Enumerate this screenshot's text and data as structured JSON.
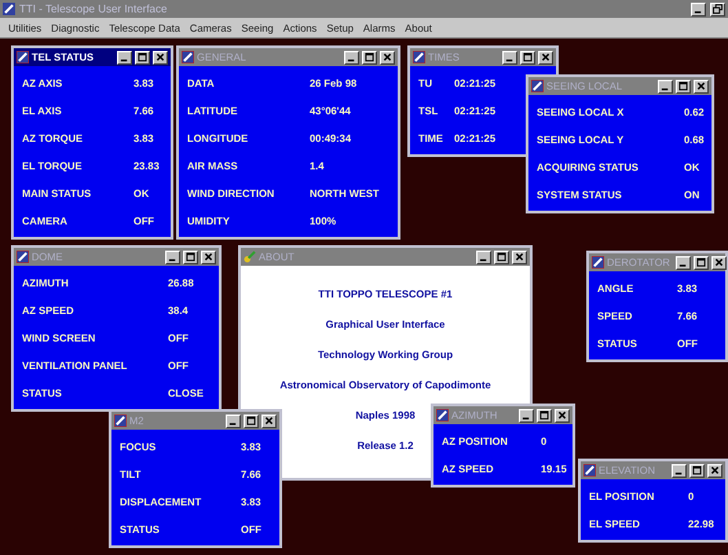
{
  "app": {
    "title": "TTI - Telescope User Interface",
    "active": false
  },
  "menu": [
    "Utilities",
    "Diagnostic",
    "Telescope Data",
    "Cameras",
    "Seeing",
    "Actions",
    "Setup",
    "Alarms",
    "About"
  ],
  "windows": [
    {
      "title": "TEL STATUS",
      "active": true,
      "kind": "table",
      "rows": [
        {
          "label": "AZ AXIS",
          "value": "3.83"
        },
        {
          "label": "EL AXIS",
          "value": "7.66"
        },
        {
          "label": "AZ TORQUE",
          "value": "3.83"
        },
        {
          "label": "EL TORQUE",
          "value": "23.83"
        },
        {
          "label": "MAIN STATUS",
          "value": "OK"
        },
        {
          "label": "CAMERA",
          "value": "OFF"
        }
      ]
    },
    {
      "title": "GENERAL",
      "active": false,
      "kind": "table",
      "rows": [
        {
          "label": "DATA",
          "value": "26 Feb 98"
        },
        {
          "label": "LATITUDE",
          "value": "43°06'44"
        },
        {
          "label": "LONGITUDE",
          "value": "00:49:34"
        },
        {
          "label": "AIR MASS",
          "value": "1.4"
        },
        {
          "label": "WIND DIRECTION",
          "value": "NORTH WEST"
        },
        {
          "label": "UMIDITY",
          "value": "100%"
        }
      ]
    },
    {
      "title": "TIMES",
      "active": false,
      "kind": "table",
      "rows": [
        {
          "label": "TU",
          "value": "02:21:25"
        },
        {
          "label": "TSL",
          "value": "02:21:25"
        },
        {
          "label": "TIME",
          "value": "02:21:25"
        }
      ]
    },
    {
      "title": "SEEING LOCAL",
      "active": false,
      "kind": "table",
      "rows": [
        {
          "label": "SEEING LOCAL X",
          "value": "0.62"
        },
        {
          "label": "SEEING LOCAL Y",
          "value": "0.68"
        },
        {
          "label": "ACQUIRING STATUS",
          "value": "OK"
        },
        {
          "label": "SYSTEM STATUS",
          "value": "ON"
        }
      ]
    },
    {
      "title": "DOME",
      "active": false,
      "kind": "table",
      "rows": [
        {
          "label": "AZIMUTH",
          "value": "26.88"
        },
        {
          "label": "AZ SPEED",
          "value": "38.4"
        },
        {
          "label": "WIND SCREEN",
          "value": "OFF"
        },
        {
          "label": "VENTILATION PANEL",
          "value": "OFF"
        },
        {
          "label": "STATUS",
          "value": "CLOSE"
        }
      ]
    },
    {
      "title": "ABOUT",
      "active": false,
      "kind": "about",
      "lines": [
        "TTI TOPPO TELESCOPE #1",
        "Graphical User Interface",
        "Technology Working Group",
        "Astronomical Observatory of Capodimonte",
        "Naples 1998",
        "Release 1.2"
      ]
    },
    {
      "title": "DEROTATOR",
      "active": false,
      "kind": "table",
      "rows": [
        {
          "label": "ANGLE",
          "value": "3.83"
        },
        {
          "label": "SPEED",
          "value": "7.66"
        },
        {
          "label": "STATUS",
          "value": "OFF"
        }
      ]
    },
    {
      "title": "M2",
      "active": false,
      "kind": "table",
      "rows": [
        {
          "label": "FOCUS",
          "value": "3.83"
        },
        {
          "label": "TILT",
          "value": "7.66"
        },
        {
          "label": "DISPLACEMENT",
          "value": "3.83"
        },
        {
          "label": "STATUS",
          "value": "OFF"
        }
      ]
    },
    {
      "title": "AZIMUTH",
      "active": false,
      "kind": "table",
      "rows": [
        {
          "label": "AZ POSITION",
          "value": "0"
        },
        {
          "label": "AZ SPEED",
          "value": "19.15"
        }
      ]
    },
    {
      "title": "ELEVATION",
      "active": false,
      "kind": "table",
      "rows": [
        {
          "label": "EL POSITION",
          "value": "0"
        },
        {
          "label": "EL SPEED",
          "value": "22.98"
        }
      ]
    }
  ]
}
